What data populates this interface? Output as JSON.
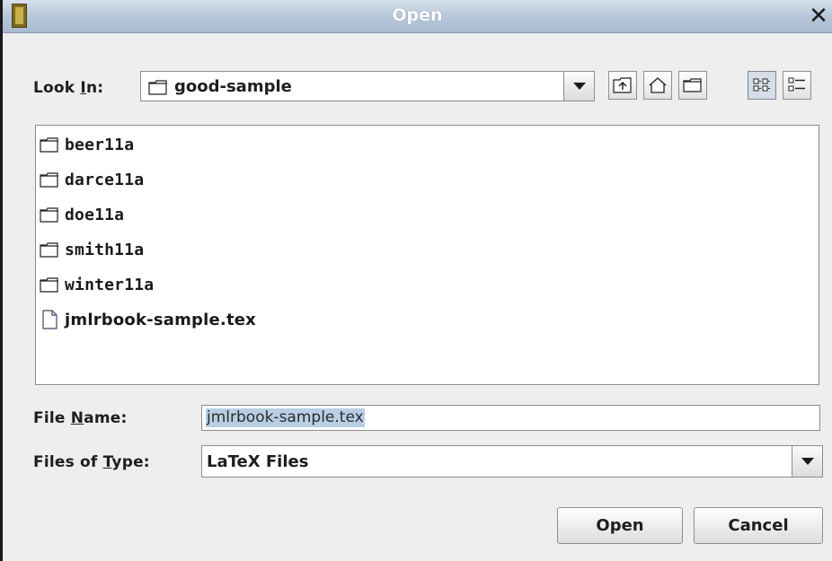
{
  "window": {
    "title": "Open"
  },
  "look_in": {
    "label_pre": "Look ",
    "label_u": "I",
    "label_post": "n:",
    "value": "good-sample"
  },
  "files": [
    {
      "name": "beer11a",
      "type": "folder",
      "icon": "folder-icon"
    },
    {
      "name": "darce11a",
      "type": "folder",
      "icon": "folder-icon"
    },
    {
      "name": "doe11a",
      "type": "folder",
      "icon": "folder-icon"
    },
    {
      "name": "smith11a",
      "type": "folder",
      "icon": "folder-icon"
    },
    {
      "name": "winter11a",
      "type": "folder",
      "icon": "folder-icon"
    },
    {
      "name": "jmlrbook-sample.tex",
      "type": "file",
      "icon": "file-icon"
    }
  ],
  "file_name": {
    "label_pre": "File ",
    "label_u": "N",
    "label_post": "ame:",
    "value": "jmlrbook-sample.tex"
  },
  "file_type": {
    "label_pre": "Files of ",
    "label_u": "T",
    "label_post": "ype:",
    "value": "LaTeX Files"
  },
  "buttons": {
    "open": "Open",
    "cancel": "Cancel"
  },
  "colors": {
    "titlebar": "#b9c9da",
    "selection": "#b8cfe5",
    "background": "#eeeeee"
  }
}
